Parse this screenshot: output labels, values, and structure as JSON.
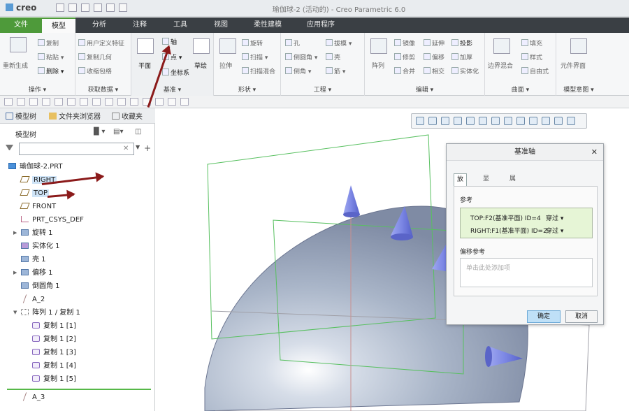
{
  "window": {
    "title": "瑜伽球-2 (活动的) - Creo Parametric 6.0",
    "logo": "creo"
  },
  "menus": [
    "文件",
    "模型",
    "分析",
    "注释",
    "工具",
    "视图",
    "柔性建模",
    "应用程序"
  ],
  "ribbon": {
    "groups": [
      {
        "label": "操作 ▾",
        "items": [
          "重新生成",
          "复制",
          "粘贴 ▾",
          "删除 ▾"
        ]
      },
      {
        "label": "获取数据 ▾",
        "items": [
          "用户定义特征",
          "复制几何",
          "收缩包络"
        ]
      },
      {
        "label": "基准 ▾",
        "items": [
          "平面",
          "轴",
          "点 ▾",
          "坐标系",
          "草绘"
        ]
      },
      {
        "label": "形状 ▾",
        "items": [
          "拉伸",
          "旋转",
          "扫描 ▾",
          "扫描混合"
        ]
      },
      {
        "label": "工程 ▾",
        "items": [
          "孔",
          "倒圆角 ▾",
          "倒角 ▾",
          "拔模 ▾",
          "壳",
          "筋 ▾"
        ]
      },
      {
        "label": "编辑 ▾",
        "items": [
          "阵列",
          "镜像",
          "修剪",
          "合并",
          "延伸",
          "偏移",
          "相交",
          "投影",
          "加厚",
          "实体化"
        ]
      },
      {
        "label": "曲面 ▾",
        "items": [
          "边界混合",
          "填充",
          "样式",
          "自由式"
        ]
      },
      {
        "label": "模型意图 ▾",
        "items": [
          "元件界面"
        ]
      }
    ]
  },
  "sidebar": {
    "tabs": [
      "模型树",
      "文件夹浏览器",
      "收藏夹"
    ],
    "tree_header": "模型树",
    "filter_placeholder": "",
    "items": [
      {
        "label": "瑜伽球-2.PRT",
        "icon": "part-icon"
      },
      {
        "label": "RIGHT",
        "icon": "datum-plane-icon",
        "highlight": true
      },
      {
        "label": "TOP",
        "icon": "datum-plane-icon",
        "highlight": true
      },
      {
        "label": "FRONT",
        "icon": "datum-plane-icon"
      },
      {
        "label": "PRT_CSYS_DEF",
        "icon": "csys-icon"
      },
      {
        "label": "旋转 1",
        "icon": "revolve-icon",
        "expand": "▶"
      },
      {
        "label": "实体化 1",
        "icon": "solidify-icon"
      },
      {
        "label": "壳 1",
        "icon": "shell-icon"
      },
      {
        "label": "偏移 1",
        "icon": "offset-icon",
        "expand": "▶"
      },
      {
        "label": "倒圆角 1",
        "icon": "round-icon"
      },
      {
        "label": "A_2",
        "icon": "axis-icon"
      },
      {
        "label": "阵列 1 / 复制 1",
        "icon": "pattern-icon",
        "expand": "▼"
      },
      {
        "label": "复制 1 [1]",
        "icon": "copy-icon"
      },
      {
        "label": "复制 1 [2]",
        "icon": "copy-icon"
      },
      {
        "label": "复制 1 [3]",
        "icon": "copy-icon"
      },
      {
        "label": "复制 1 [4]",
        "icon": "copy-icon"
      },
      {
        "label": "复制 1 [5]",
        "icon": "copy-icon"
      },
      {
        "label": "A_3",
        "icon": "axis-icon"
      }
    ]
  },
  "dialog": {
    "title": "基准轴",
    "tabs": [
      "放置",
      "显示",
      "属性"
    ],
    "refs_label": "参考",
    "refs": [
      {
        "name": "TOP:F2(基准平面) ID=4",
        "type": "穿过 ▾"
      },
      {
        "name": "RIGHT:F1(基准平面) ID=2",
        "type": "穿过 ▾"
      }
    ],
    "offset_label": "偏移参考",
    "offset_placeholder": "单击此处添加项",
    "ok": "确定",
    "cancel": "取消"
  },
  "colors": {
    "accent": "#4e9a3a",
    "arrow": "#8b1a1a",
    "highlight": "#cfe4f7",
    "ref_bg": "#e6f5d6"
  }
}
